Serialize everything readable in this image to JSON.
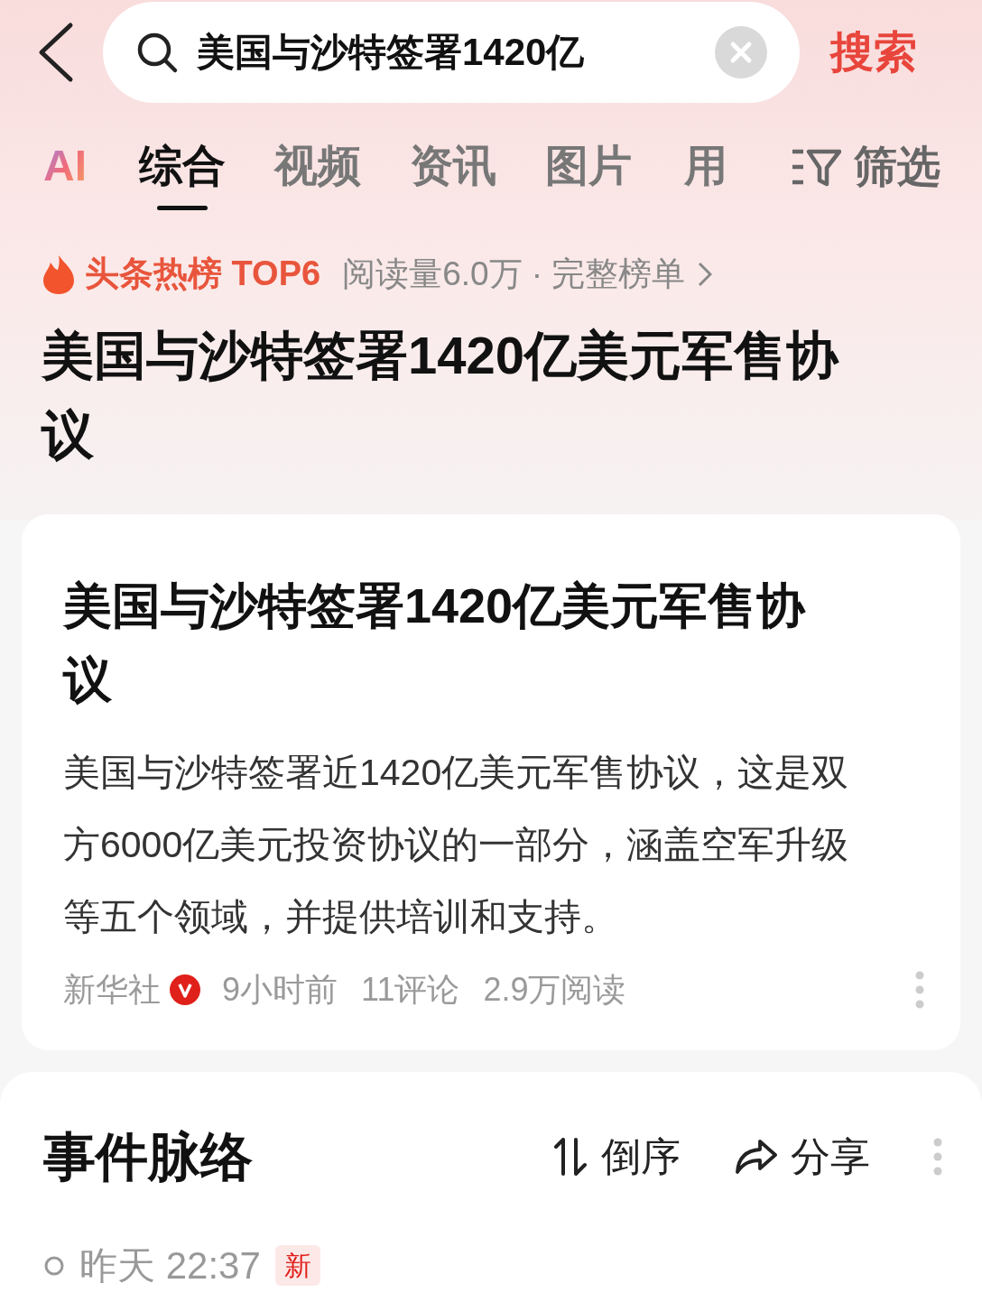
{
  "search": {
    "value": "美国与沙特签署1420亿",
    "button": "搜索"
  },
  "tabs": [
    {
      "label": "AI",
      "kind": "ai",
      "selected": false
    },
    {
      "label": "综合",
      "kind": "text",
      "selected": true
    },
    {
      "label": "视频",
      "kind": "text",
      "selected": false
    },
    {
      "label": "资讯",
      "kind": "text",
      "selected": false
    },
    {
      "label": "图片",
      "kind": "text",
      "selected": false
    },
    {
      "label": "用",
      "kind": "text",
      "selected": false
    }
  ],
  "filter": "筛选",
  "hot": {
    "badge": "头条热榜 TOP6",
    "reads": "阅读量6.0万 · 完整榜单",
    "title": "美国与沙特签署1420亿美元军售协议"
  },
  "article": {
    "title": "美国与沙特签署1420亿美元军售协议",
    "summary": "美国与沙特签署近1420亿美元军售协议，这是双方6000亿美元投资协议的一部分，涵盖空军升级等五个领域，并提供培训和支持。",
    "source": "新华社",
    "verified": true,
    "time": "9小时前",
    "comments": "11评论",
    "reads": "2.9万阅读"
  },
  "timeline": {
    "title": "事件脉络",
    "sort": "倒序",
    "share": "分享",
    "first": {
      "time": "昨天 22:37",
      "badge": "新"
    }
  }
}
